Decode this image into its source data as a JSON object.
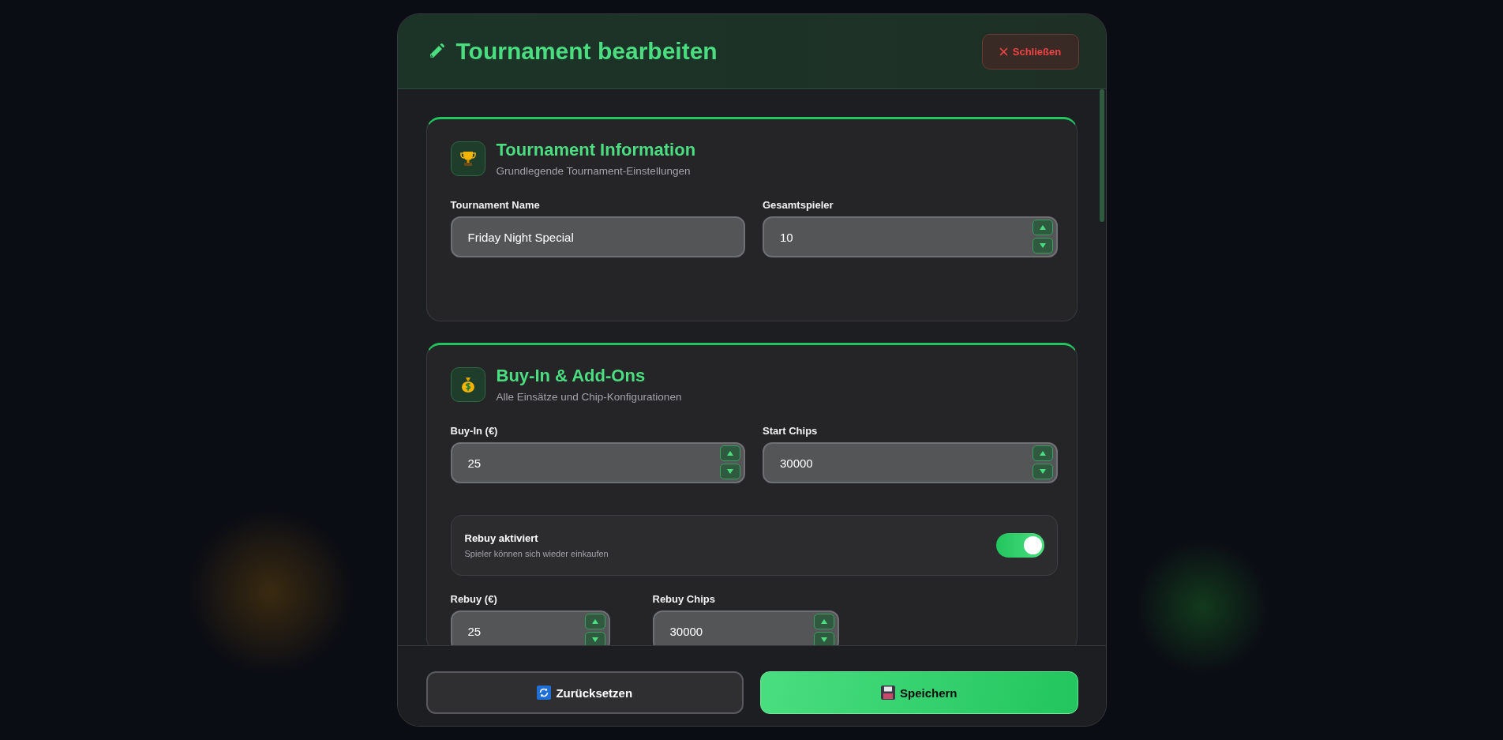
{
  "dialog": {
    "title": "Tournament bearbeiten",
    "close_button": "Schließen"
  },
  "sections": [
    {
      "title": "Tournament Information",
      "subtitle": "Grundlegende Tournament-Einstellungen",
      "rows": [
        {
          "kind": "fields",
          "fields": [
            {
              "label": "Tournament Name",
              "value": "Friday Night Special",
              "kind": "text"
            },
            {
              "label": "Gesamtspieler",
              "value": "10",
              "kind": "number"
            }
          ]
        }
      ]
    },
    {
      "title": "Buy-In & Add-Ons",
      "subtitle": "Alle Einsätze und Chip-Konfigurationen",
      "rows": [
        {
          "kind": "fields",
          "fields": [
            {
              "label": "Buy-In (€)",
              "value": "25",
              "kind": "number"
            },
            {
              "label": "Start Chips",
              "value": "30000",
              "kind": "number"
            }
          ]
        },
        {
          "kind": "toggle",
          "title": "Rebuy aktiviert",
          "description": "Spieler können sich wieder einkaufen",
          "on": true
        },
        {
          "kind": "compact-fields",
          "fields": [
            {
              "label": "Rebuy (€)",
              "value": "25",
              "kind": "number"
            },
            {
              "label": "Rebuy Chips",
              "value": "30000",
              "kind": "number"
            }
          ]
        }
      ]
    }
  ],
  "footer": {
    "buttons": [
      {
        "label": "Zurücksetzen",
        "kind": "secondary"
      },
      {
        "label": "Speichern",
        "kind": "primary"
      }
    ]
  }
}
